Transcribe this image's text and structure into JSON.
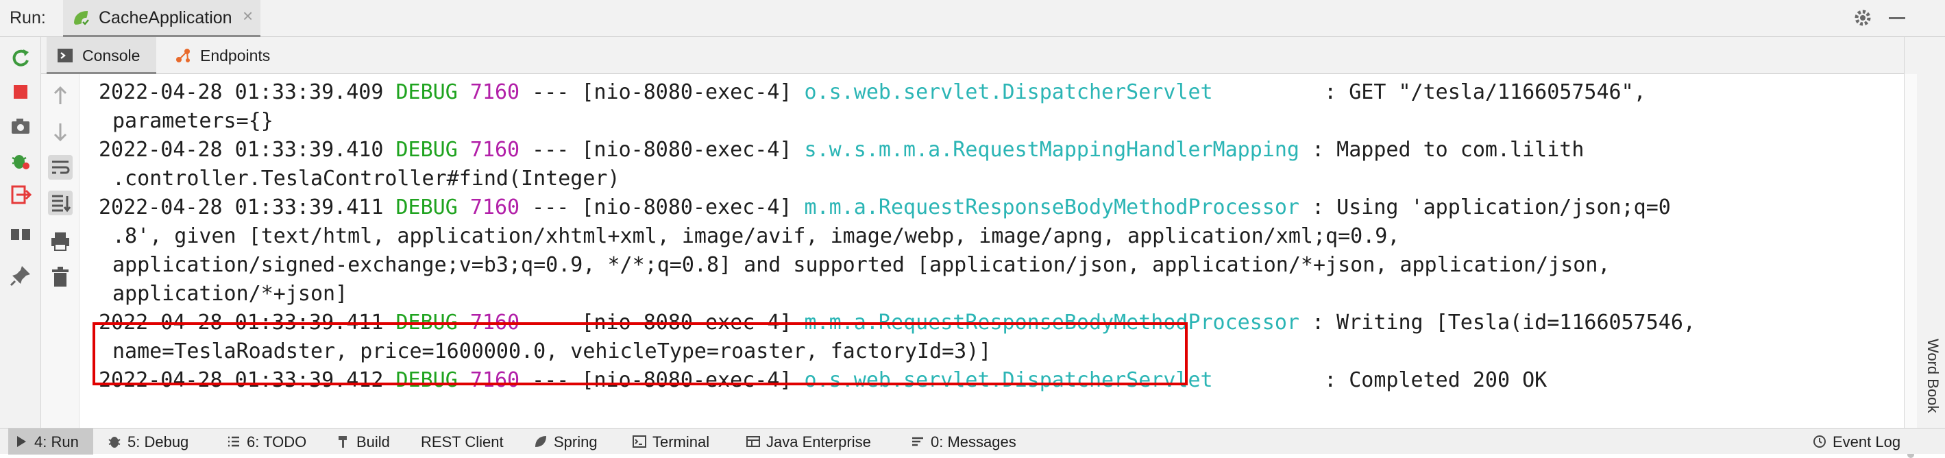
{
  "run_bar": {
    "label": "Run:",
    "tab_title": "CacheApplication",
    "close_glyph": "×"
  },
  "tabs": {
    "console": "Console",
    "endpoints": "Endpoints"
  },
  "log": {
    "lines": [
      {
        "ts": "2022-04-28 01:33:39.409",
        "level": "DEBUG",
        "pid": "7160",
        "sep": "---",
        "thread": "[nio-8080-exec-4]",
        "logger": "o.s.web.servlet.DispatcherServlet        ",
        "msg": ": GET \"/tesla/1166057546\",",
        "cont": [
          "parameters={}"
        ]
      },
      {
        "ts": "2022-04-28 01:33:39.410",
        "level": "DEBUG",
        "pid": "7160",
        "sep": "---",
        "thread": "[nio-8080-exec-4]",
        "logger": "s.w.s.m.m.a.RequestMappingHandlerMapping",
        "msg": ": Mapped to com.lilith",
        "cont": [
          ".controller.TeslaController#find(Integer)"
        ]
      },
      {
        "ts": "2022-04-28 01:33:39.411",
        "level": "DEBUG",
        "pid": "7160",
        "sep": "---",
        "thread": "[nio-8080-exec-4]",
        "logger": "m.m.a.RequestResponseBodyMethodProcessor",
        "msg": ": Using 'application/json;q=0",
        "cont": [
          ".8', given [text/html, application/xhtml+xml, image/avif, image/webp, image/apng, application/xml;q=0.9,",
          "application/signed-exchange;v=b3;q=0.9, */*;q=0.8] and supported [application/json, application/*+json, application/json,",
          "application/*+json]"
        ]
      },
      {
        "ts": "2022-04-28 01:33:39.411",
        "level": "DEBUG",
        "pid": "7160",
        "sep": "---",
        "thread": "[nio-8080-exec-4]",
        "logger": "m.m.a.RequestResponseBodyMethodProcessor",
        "msg": ": Writing [Tesla(id=1166057546,",
        "cont": [
          "name=TeslaRoadster, price=1600000.0, vehicleType=roaster, factoryId=3)]"
        ]
      },
      {
        "ts": "2022-04-28 01:33:39.412",
        "level": "DEBUG",
        "pid": "7160",
        "sep": "---",
        "thread": "[nio-8080-exec-4]",
        "logger": "o.s.web.servlet.DispatcherServlet        ",
        "msg": ": Completed 200 OK",
        "cont": []
      }
    ]
  },
  "right_strip": {
    "word_book": "Word Book"
  },
  "bottom_bar": {
    "items": [
      {
        "label": "4: Run",
        "icon": "play-icon",
        "active": true
      },
      {
        "label": "5: Debug",
        "icon": "bug-icon"
      },
      {
        "label": "6: TODO",
        "icon": "list-icon"
      },
      {
        "label": "Build",
        "icon": "hammer-icon"
      },
      {
        "label": "REST Client",
        "icon": "none"
      },
      {
        "label": "Spring",
        "icon": "leaf-icon"
      },
      {
        "label": "Terminal",
        "icon": "terminal-icon"
      },
      {
        "label": "Java Enterprise",
        "icon": "enterprise-icon"
      },
      {
        "label": "0: Messages",
        "icon": "messages-icon"
      }
    ],
    "event_log": "Event Log"
  },
  "colors": {
    "debug": "#1fa31f",
    "pid": "#b21fa8",
    "logger": "#2bb5b5",
    "highlight_border": "#e00000"
  }
}
